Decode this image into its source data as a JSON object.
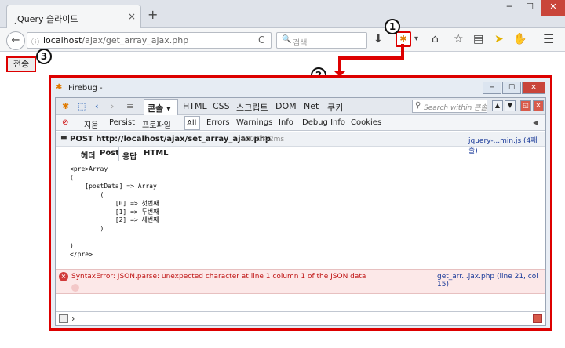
{
  "browser": {
    "tab_title": "jQuery 슬라이드",
    "tab_close": "×",
    "new_tab": "+",
    "window_min": "─",
    "window_max": "☐",
    "window_close": "✕",
    "back": "←",
    "info": "ⓘ",
    "url_host": "localhost",
    "url_path": "/ajax/get_array_ajax.php",
    "reload": "C",
    "search_glyph": "🔍",
    "search_placeholder": "검색",
    "firebug_icon": "✱",
    "dropdown": "▾"
  },
  "page": {
    "send_button": "전송"
  },
  "annotations": {
    "badge_1": "1",
    "badge_2": "2",
    "badge_3": "3"
  },
  "firebug": {
    "title": "Firebug -",
    "title_min": "─",
    "title_max": "☐",
    "title_close": "✕",
    "tabs": {
      "console": "콘솔 ▾",
      "html": "HTML",
      "css": "CSS",
      "script": "스크립트",
      "dom": "DOM",
      "net": "Net",
      "cookie": "쿠키"
    },
    "search_placeholder": "Search within 콘솔",
    "filters": {
      "clear": "지움",
      "persist": "Persist",
      "profile": "프로파일",
      "all": "All",
      "errors": "Errors",
      "warnings": "Warnings",
      "info": "Info",
      "debug_info": "Debug Info",
      "cookies": "Cookies"
    },
    "request": {
      "method_url": "POST http://localhost/ajax/set_array_ajax.php",
      "status": "200 OK 2ms",
      "source": "jquery-...min.js (4째 줄)",
      "tabs": {
        "headers": "헤더",
        "post": "Post",
        "response": "응답",
        "html": "HTML"
      },
      "response_body": "<pre>Array\n(\n    [postData] => Array\n        (\n            [0] => 첫번째\n            [1] => 두번째\n            [2] => 세번째\n        )\n\n)\n</pre>"
    },
    "error": {
      "message": "SyntaxError: JSON.parse: unexpected character at line 1 column 1 of the JSON data",
      "source": "get_arr...jax.php (line 21, col 15)"
    },
    "command_prompt": "›"
  }
}
